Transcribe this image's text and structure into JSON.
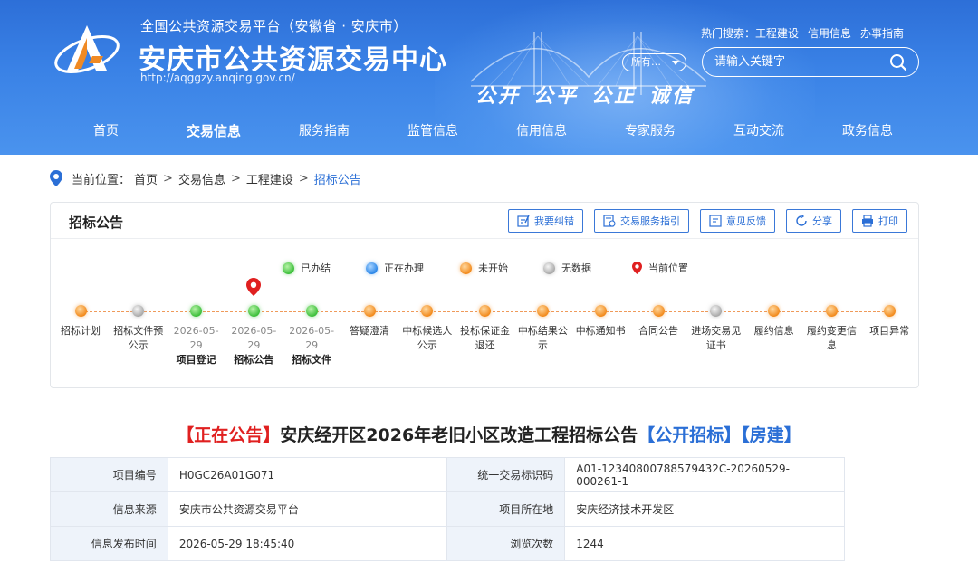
{
  "header": {
    "subtitle": "全国公共资源交易平台（安徽省 · 安庆市）",
    "title": "安庆市公共资源交易中心",
    "url": "http://aqggzy.anqing.gov.cn/",
    "slogan": [
      "公开",
      "公平",
      "公正",
      "诚信"
    ],
    "hot_search_label": "热门搜索：",
    "hot_search_items": [
      "工程建设",
      "信用信息",
      "办事指南"
    ],
    "scope_select": "所有…",
    "search_placeholder": "请输入关键字"
  },
  "nav": [
    "首页",
    "交易信息",
    "服务指南",
    "监管信息",
    "信用信息",
    "专家服务",
    "互动交流",
    "政务信息"
  ],
  "nav_active_index": 1,
  "breadcrumb": {
    "label": "当前位置：",
    "items": [
      "首页",
      "交易信息",
      "工程建设",
      "招标公告"
    ],
    "separator": ">"
  },
  "panel": {
    "title": "招标公告",
    "buttons": [
      "我要纠错",
      "交易服务指引",
      "意见反馈",
      "分享",
      "打印"
    ],
    "legend": [
      {
        "label": "已办结",
        "status": "done",
        "color": "#3cbf3a"
      },
      {
        "label": "正在办理",
        "status": "processing",
        "color": "#2a86e8"
      },
      {
        "label": "未开始",
        "status": "pending",
        "color": "#f28a1c"
      },
      {
        "label": "无数据",
        "status": "nodata",
        "color": "#a9a9a9"
      },
      {
        "label": "当前位置",
        "status": "current",
        "color": "#e02020"
      }
    ],
    "steps": [
      {
        "label": "招标计划",
        "status": "pending"
      },
      {
        "label": "招标文件预公示",
        "status": "nodata"
      },
      {
        "date": "2026-05-29",
        "label": "项目登记",
        "status": "done"
      },
      {
        "date": "2026-05-29",
        "label": "招标公告",
        "status": "done",
        "current": true
      },
      {
        "date": "2026-05-29",
        "label": "招标文件",
        "status": "done"
      },
      {
        "label": "答疑澄清",
        "status": "pending"
      },
      {
        "label": "中标候选人公示",
        "status": "pending"
      },
      {
        "label": "投标保证金退还",
        "status": "pending"
      },
      {
        "label": "中标结果公示",
        "status": "pending"
      },
      {
        "label": "中标通知书",
        "status": "pending"
      },
      {
        "label": "合同公告",
        "status": "pending"
      },
      {
        "label": "进场交易见证书",
        "status": "nodata"
      },
      {
        "label": "履约信息",
        "status": "pending"
      },
      {
        "label": "履约变更信息",
        "status": "pending"
      },
      {
        "label": "项目异常",
        "status": "pending"
      }
    ]
  },
  "notice": {
    "status": "【正在公告】",
    "title": "安庆经开区2026年老旧小区改造工程招标公告",
    "tag1": "【公开招标】",
    "tag2": "【房建】"
  },
  "info": {
    "rows": [
      {
        "k1": "项目编号",
        "v1": "H0GC26A01G071",
        "k2": "统一交易标识码",
        "v2": "A01-12340800788579432C-20260529-000261-1"
      },
      {
        "k1": "信息来源",
        "v1": "安庆市公共资源交易平台",
        "k2": "项目所在地",
        "v2": "安庆经济技术开发区"
      },
      {
        "k1": "信息发布时间",
        "v1": "2026-05-29 18:45:40",
        "k2": "浏览次数",
        "v2": "1244"
      }
    ]
  },
  "colors": {
    "header_blue": "#3a82e6",
    "link_blue": "#2b6fd6",
    "status_red": "#e02020"
  }
}
